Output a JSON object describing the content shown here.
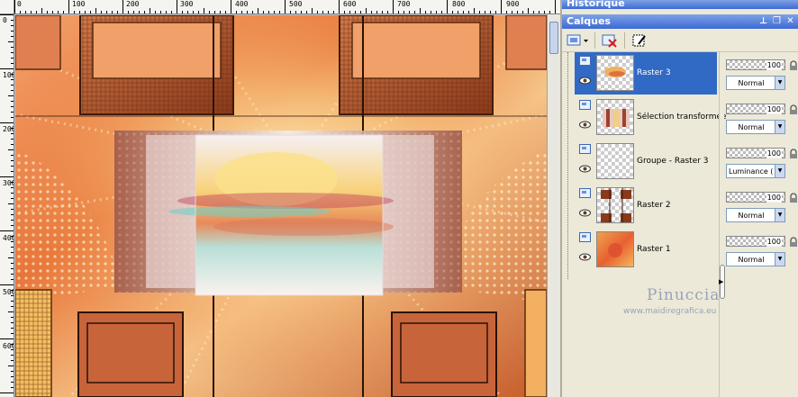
{
  "window": {
    "history_palette_title": "Historique",
    "layers_palette_title": "Calques"
  },
  "rulers": {
    "top_labels": [
      "0",
      "100",
      "200",
      "300",
      "400",
      "500",
      "600",
      "700",
      "800",
      "900"
    ],
    "left_labels": [
      "0",
      "100",
      "200",
      "300",
      "400",
      "500",
      "600"
    ]
  },
  "layers": [
    {
      "name": "Raster 3",
      "selected": true,
      "opacity": "100",
      "blend": "Normal",
      "thumb": "sun"
    },
    {
      "name": "Sélection transformée",
      "selected": false,
      "opacity": "100",
      "blend": "Normal",
      "thumb": "stripes"
    },
    {
      "name": "Groupe - Raster 3",
      "selected": false,
      "opacity": "100",
      "blend": "Luminance (H)",
      "thumb": "empty"
    },
    {
      "name": "Raster 2",
      "selected": false,
      "opacity": "100",
      "blend": "Normal",
      "thumb": "frames"
    },
    {
      "name": "Raster 1",
      "selected": false,
      "opacity": "100",
      "blend": "Normal",
      "thumb": "full"
    }
  ],
  "watermark": {
    "name": "Pinuccia",
    "url": "www.maidiregrafica.eu"
  },
  "colors": {
    "title_bar": "#3d6ad6",
    "selected_layer": "#316ac5",
    "panel_bg": "#ece9d8"
  },
  "icons": [
    "new-layer-icon",
    "delete-layer-icon",
    "mask-icon",
    "eye-icon",
    "lock-icon",
    "layer-type-icon"
  ]
}
